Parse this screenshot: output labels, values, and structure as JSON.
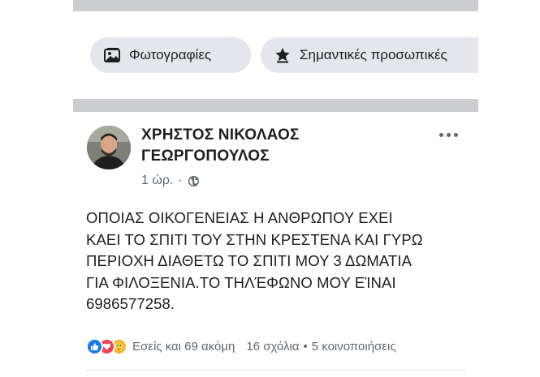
{
  "filter_chips": [
    {
      "label": "Φωτογραφίες",
      "icon": "photos-icon"
    },
    {
      "label": "Σημαντικές προσωπικές",
      "icon": "star-icon"
    }
  ],
  "post": {
    "author": "ΧΡΗΣΤΟΣ ΝΙΚΟΛΑΟΣ ΓΕΩΡΓΟΠΟΥΛΟΣ",
    "time": "1 ώρ.",
    "separator": "·",
    "audience_icon": "globe-icon",
    "body": "ΟΠΟΙΑΣ ΟΙΚΟΓΕΝΕΙΑΣ Η ΑΝΘΡΩΠΟΥ ΕΧΕΙ\nΚΑΕΙ ΤΟ ΣΠΙΤΙ ΤΟΥ ΣΤΗΝ ΚΡΕΣΤΕΝΑ ΚΑΙ ΓΥΡΩ\nΠΕΡΙΟΧΗ ΔΙΑΘΕΤΩ ΤΟ ΣΠΙΤΙ ΜΟΥ 3 ΔΩΜΑΤΙΑ\nΓΙΑ ΦΙΛΟΞΕΝΙΑ.ΤΟ ΤΗΛΈΦΩΝΟ ΜΟΥ ΕΊΝΑΙ\n6986577258.",
    "reactions_text": "Εσείς και 69 ακόμη",
    "comments_text": "16 σχόλια",
    "shares_text": "5 κοινοποιήσεις",
    "stats_separator": "•"
  },
  "colors": {
    "like": "#1877f2",
    "love": "#f33e58",
    "care": "#f7b125",
    "band": "#cbcdd1",
    "chip": "#e4e6eb"
  }
}
